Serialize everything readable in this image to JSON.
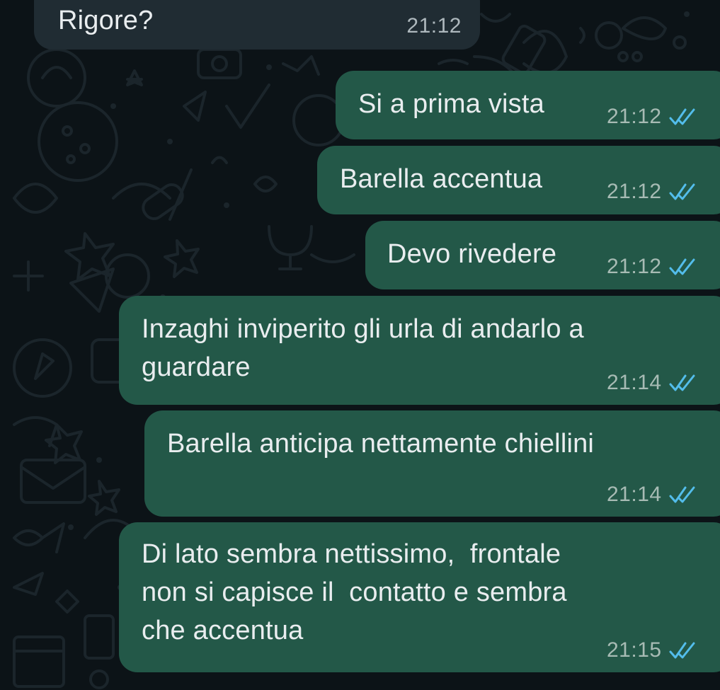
{
  "colors": {
    "background": "#0c1317",
    "incoming_bubble": "#202c33",
    "outgoing_bubble": "#235848",
    "text": "#e9edef",
    "timestamp": "#a7bbb4",
    "read_ticks": "#53bdeb"
  },
  "icons": {
    "read_receipt": "double-check-icon"
  },
  "messages": [
    {
      "direction": "incoming",
      "text": "Rigore?",
      "time": "21:12"
    },
    {
      "direction": "outgoing",
      "text": "Si a prima vista",
      "time": "21:12",
      "status": "read"
    },
    {
      "direction": "outgoing",
      "text": "Barella accentua",
      "time": "21:12",
      "status": "read"
    },
    {
      "direction": "outgoing",
      "text": "Devo rivedere",
      "time": "21:12",
      "status": "read"
    },
    {
      "direction": "outgoing",
      "text": "Inzaghi inviperito gli urla di andarlo a\nguardare",
      "time": "21:14",
      "status": "read"
    },
    {
      "direction": "outgoing",
      "text": "Barella anticipa nettamente chiellini",
      "time": "21:14",
      "status": "read"
    },
    {
      "direction": "outgoing",
      "text": "Di lato sembra nettissimo,  frontale\nnon si capisce il  contatto e sembra\nche accentua",
      "time": "21:15",
      "status": "read"
    }
  ]
}
